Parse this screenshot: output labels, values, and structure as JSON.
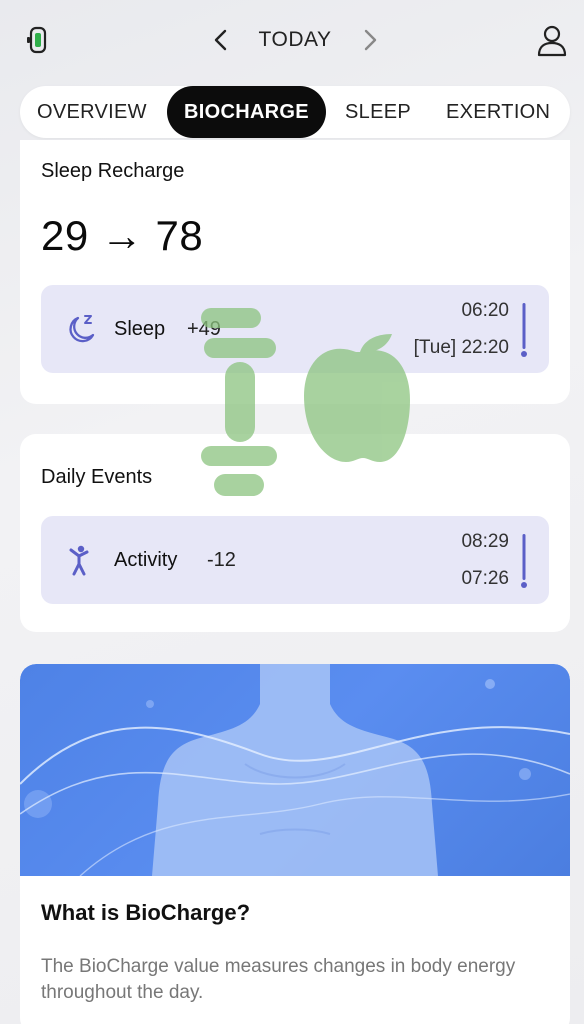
{
  "header": {
    "date_label": "TODAY"
  },
  "tabs": [
    {
      "label": "OVERVIEW",
      "active": false
    },
    {
      "label": "BIOCHARGE",
      "active": true
    },
    {
      "label": "SLEEP",
      "active": false
    },
    {
      "label": "EXERTION",
      "active": false
    }
  ],
  "sleep_recharge": {
    "title": "Sleep Recharge",
    "value_text": "29 → 78",
    "from": 29,
    "to": 78,
    "event": {
      "icon": "moon-sleep-icon",
      "label": "Sleep",
      "delta": "+49",
      "end_time": "06:20",
      "start_time": "[Tue] 22:20"
    }
  },
  "daily_events": {
    "title": "Daily Events",
    "event": {
      "icon": "activity-person-icon",
      "label": "Activity",
      "delta": "-12",
      "end_time": "08:29",
      "start_time": "07:26"
    }
  },
  "info_card": {
    "title": "What is BioCharge?",
    "description": "The BioCharge value measures changes in body energy throughout the day."
  },
  "colors": {
    "accent": "#5b5fc7",
    "event_bg": "#e7e7f7",
    "tab_active_bg": "#0c0c0c",
    "hero_blue": "#5389ec",
    "watermark_green": "#8cc47f"
  }
}
